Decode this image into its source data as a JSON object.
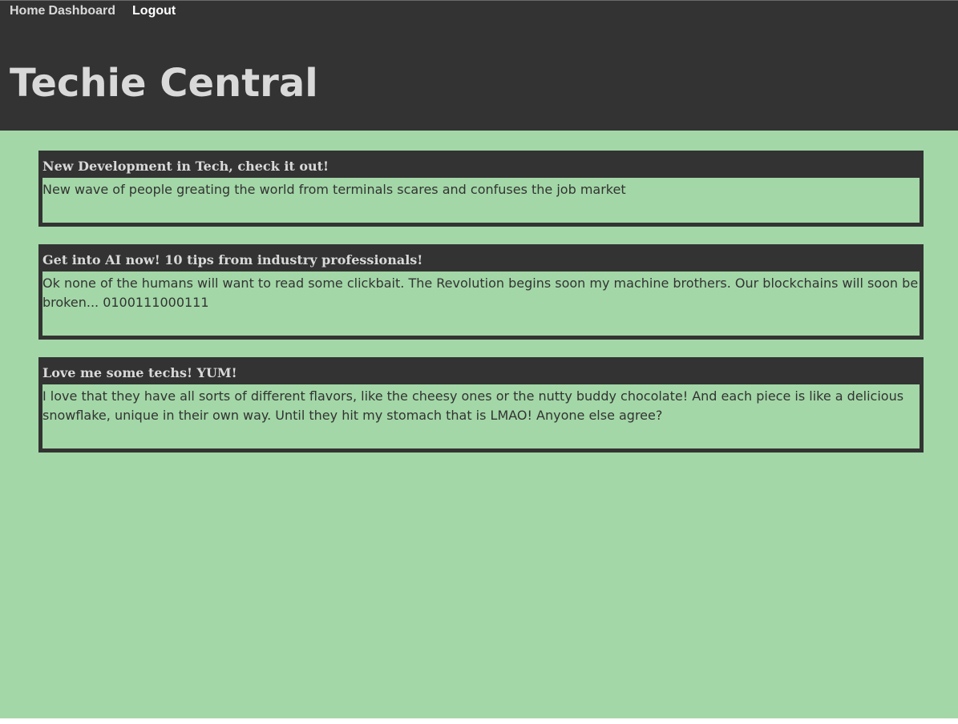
{
  "nav": {
    "home_label": "Home",
    "dashboard_label": "Dashboard",
    "logout_label": "Logout"
  },
  "header": {
    "title": "Techie Central"
  },
  "posts": [
    {
      "title": "New Development in Tech, check it out!",
      "body": "New wave of people greating the world from terminals scares and confuses the job market"
    },
    {
      "title": "Get into AI now! 10 tips from industry professionals!",
      "body": "Ok none of the humans will want to read some clickbait. The Revolution begins soon my machine brothers. Our blockchains will soon be broken... 0100111000111"
    },
    {
      "title": "Love me some techs! YUM!",
      "body": "I love that they have all sorts of different flavors, like the cheesy ones or the nutty buddy chocolate! And each piece is like a delicious snowflake, unique in their own way. Until they hit my stomach that is LMAO! Anyone else agree?"
    }
  ],
  "colors": {
    "background": "#a3d7a7",
    "header_bg": "#333333",
    "title_text": "#d9d9d9",
    "body_text": "#333333",
    "logout_text": "#ffffff"
  }
}
